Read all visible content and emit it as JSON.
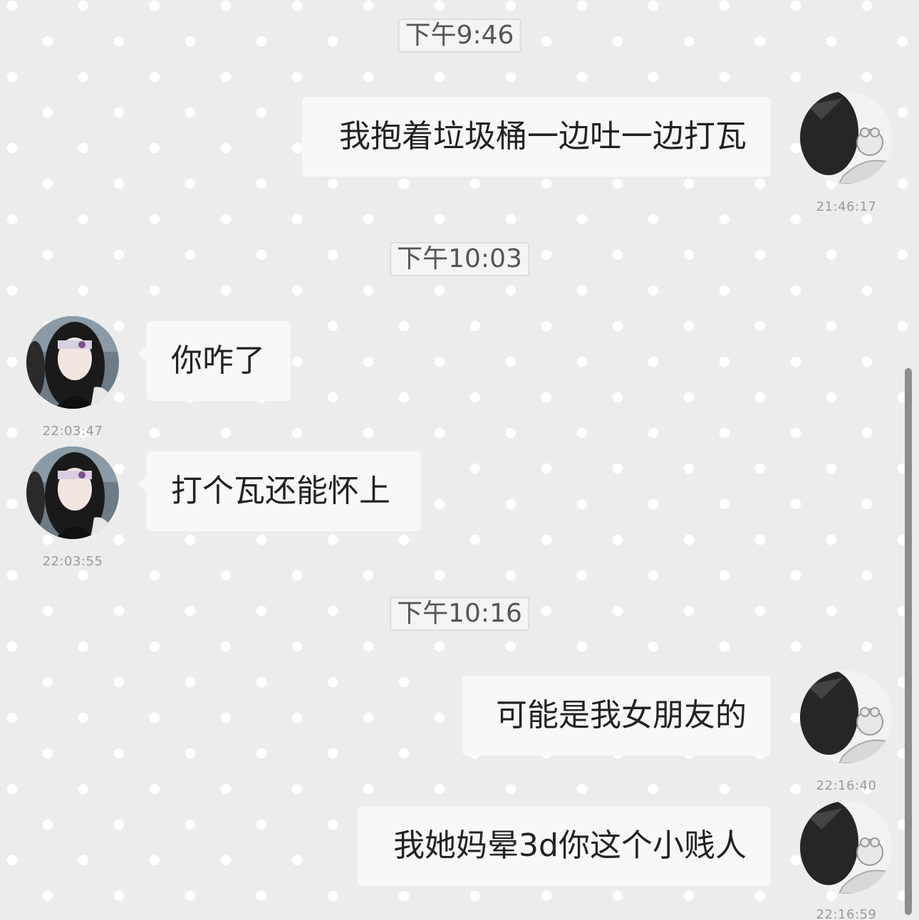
{
  "conversation": {
    "time_dividers": [
      "下午9:46",
      "下午10:03",
      "下午10:16"
    ],
    "messages": [
      {
        "side": "right",
        "text": "我抱着垃圾桶一边吐一边打瓦",
        "time": "21:46:17"
      },
      {
        "side": "left",
        "text": "你咋了",
        "time": "22:03:47"
      },
      {
        "side": "left",
        "text": "打个瓦还能怀上",
        "time": "22:03:55"
      },
      {
        "side": "right",
        "text": "可能是我女朋友的",
        "time": "22:16:40"
      },
      {
        "side": "right",
        "text": "我她妈晕3d你这个小贱人",
        "time": "22:16:59"
      }
    ]
  }
}
